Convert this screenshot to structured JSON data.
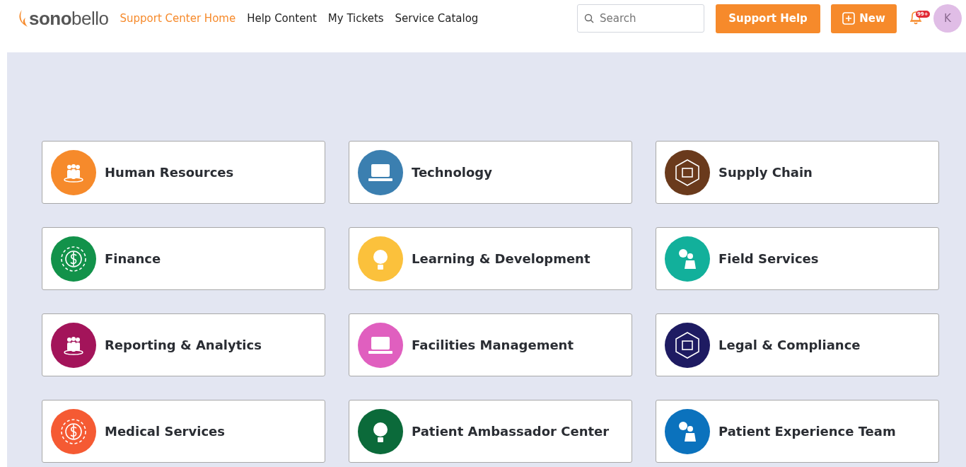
{
  "header": {
    "logo": "**sono**bello",
    "nav": [
      {
        "label": "Support Center Home",
        "selected": true
      },
      {
        "label": "Help Content",
        "selected": false
      },
      {
        "label": "My Tickets",
        "selected": false
      },
      {
        "label": "Service Catalog",
        "selected": false
      }
    ],
    "search": {
      "placeholder": "Search"
    },
    "support_button": "Support Help",
    "new_button": "New",
    "notification_badge": "99+",
    "avatar": "K"
  },
  "categories": [
    {
      "label": "Human Resources",
      "color": "#f68a2b"
    },
    {
      "label": "Technology",
      "color": "#3b7fb0"
    },
    {
      "label": "Supply Chain",
      "color": "#6a3a1c"
    },
    {
      "label": "Finance",
      "color": "#12924a"
    },
    {
      "label": "Learning & Development",
      "color": "#fbc13c"
    },
    {
      "label": "Field Services",
      "color": "#12b09b"
    },
    {
      "label": "Reporting & Analytics",
      "color": "#a3145a"
    },
    {
      "label": "Facilities Management",
      "color": "#e05fbf"
    },
    {
      "label": "Legal & Compliance",
      "color": "#1e1b62"
    },
    {
      "label": "Medical Services",
      "color": "#f55a33"
    },
    {
      "label": "Patient Ambassador Center",
      "color": "#0b6a3a"
    },
    {
      "label": "Patient Experience Team",
      "color": "#0b72bd"
    }
  ]
}
